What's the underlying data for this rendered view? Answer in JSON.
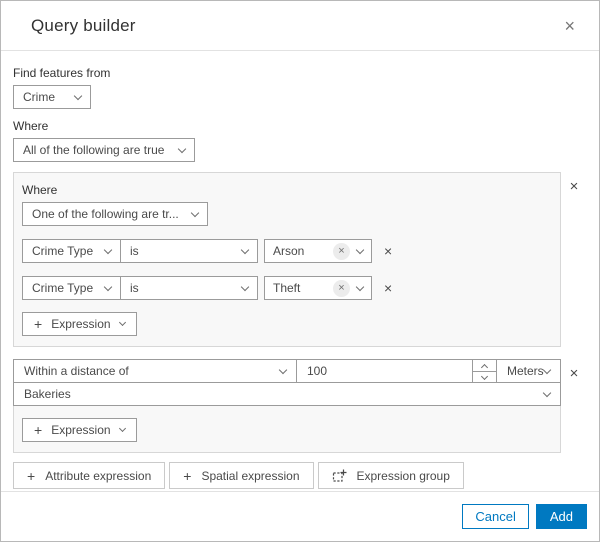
{
  "icons": {
    "close": "×",
    "remove": "×",
    "clear": "×",
    "plus": "+"
  },
  "colors": {
    "accent": "#0079c1",
    "group_bg": "#f8f8f8",
    "control_border": "#9b9b9b"
  },
  "dialog": {
    "title": "Query builder"
  },
  "find_features": {
    "label": "Find features from",
    "layer_select": "Crime"
  },
  "where": {
    "label": "Where",
    "operator_select": "All of the following are true"
  },
  "group1": {
    "label": "Where",
    "operator_select": "One of the following are tr...",
    "rows": [
      {
        "field": "Crime Type",
        "operator": "is",
        "value": "Arson"
      },
      {
        "field": "Crime Type",
        "operator": "is",
        "value": "Theft"
      }
    ],
    "add_expression_label": "Expression"
  },
  "group2": {
    "mode_select": "Within a distance of",
    "distance_value": "100",
    "unit_select": "Meters",
    "layer_select": "Bakeries",
    "add_expression_label": "Expression"
  },
  "actions": {
    "attribute_expression": "Attribute expression",
    "spatial_expression": "Spatial expression",
    "expression_group": "Expression group"
  },
  "footer": {
    "cancel": "Cancel",
    "add": "Add"
  }
}
